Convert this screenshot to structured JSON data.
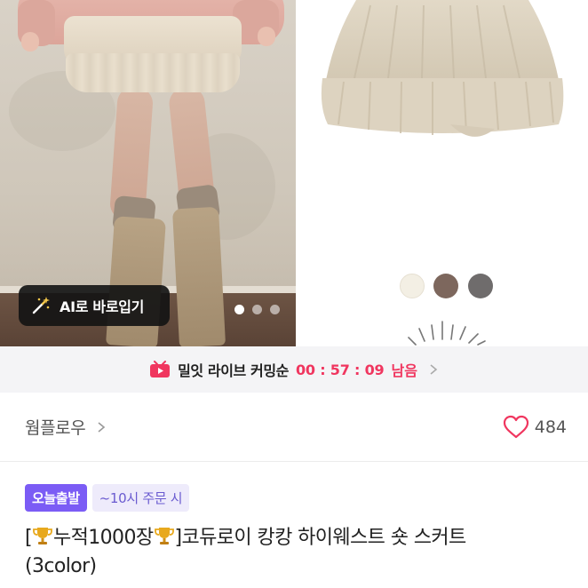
{
  "ai_chip": {
    "label": "AI로 바로입기",
    "icon": "magic-wand-icon"
  },
  "carousel": {
    "total": 3,
    "active": 0
  },
  "swatches": [
    "#f3efe4",
    "#7d675d",
    "#6f6c6c"
  ],
  "live": {
    "text": "밀잇 라이브 커밍순",
    "timer": "00 : 57 : 09",
    "suffix": "남음",
    "icon": "live-play-icon",
    "accent": "#f0365f"
  },
  "seller": {
    "name": "웜플로우",
    "likes": "484"
  },
  "badges": {
    "today": "오늘출발",
    "cutoff": "~10시 주문 시"
  },
  "product": {
    "title_line1_prefix": "[",
    "title_count": "누적1000장",
    "title_suffix": "]코듀로이 캉캉 하이웨스트 숏 스커트",
    "title_line2": "(3color)"
  },
  "colors": {
    "badge_purple": "#7b5cf5",
    "heart": "#f0365f"
  }
}
